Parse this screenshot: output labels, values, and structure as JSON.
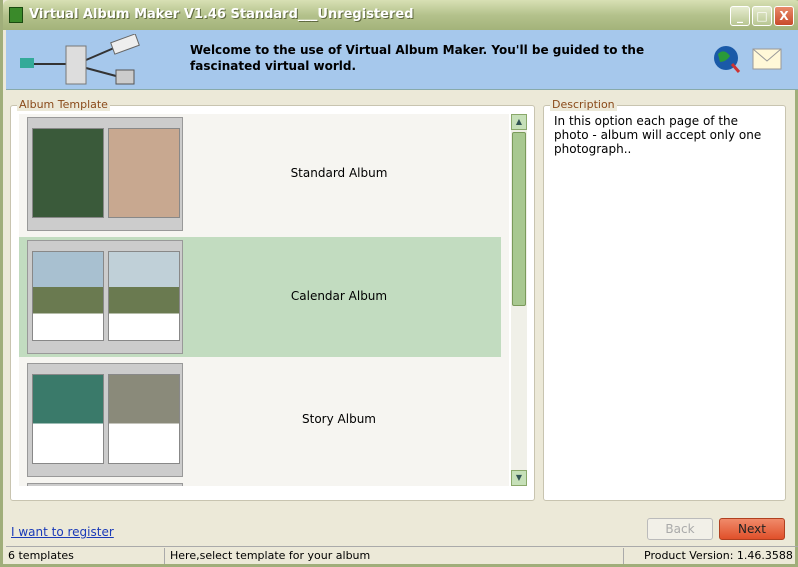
{
  "window": {
    "title": "Virtual Album Maker V1.46 Standard___Unregistered"
  },
  "banner": {
    "message": "Welcome to the use of Virtual Album Maker. You'll be guided to the fascinated virtual world."
  },
  "template_group": {
    "label": "Album Template",
    "items": [
      {
        "label": "Standard Album",
        "selected": false
      },
      {
        "label": "Calendar Album",
        "selected": true
      },
      {
        "label": "Story Album",
        "selected": false
      }
    ]
  },
  "description": {
    "label": "Description",
    "text": "In this option each page of the photo - album will accept only one photograph.."
  },
  "register_link": "I want to register",
  "buttons": {
    "back": "Back",
    "next": "Next"
  },
  "status": {
    "count": "6 templates",
    "hint": "Here,select template for your album",
    "version": "Product Version:  1.46.3588"
  }
}
